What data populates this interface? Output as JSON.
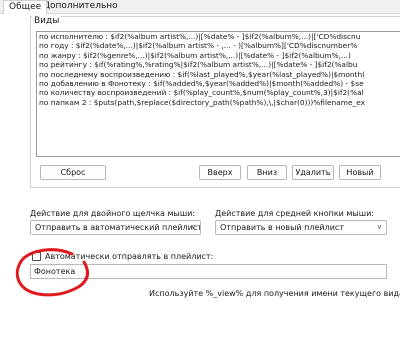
{
  "tabs": [
    {
      "label": "Общее",
      "active": true
    },
    {
      "label": "Дополнительно",
      "active": false
    }
  ],
  "views_group": {
    "label": "Виды",
    "rows": [
      "по исполнителю : $if2(%album artist%,...)|[%date% - ]$if2(%album%,...)|['CD%discnu",
      "по году : $if2(%date%,...)|$if2(%album artist% - ,... - )[%album%]['CD%discnumber%",
      "по жанру : $if2(%genre%,...)|$if2(%album artist%,...)|[%date% - ]$if2(%album%,...)",
      "по рейтингу : $if(%rating%,%rating%|$if2(%album artist%,...)|[%date% - ]$if2(%albu",
      "по последнему воспроизведению : $if(%last_played%,$year(%last_played%)|$month(",
      "по добавлению в Фонотеку : $if(%added%,$year(%added%)|$month(%added%) - $se",
      "по количеству воспроизведений : $if(%play_count%,$num(%play_count%,3)|$if2(%al",
      "по папкам 2 : $puts(path,$replace($directory_path(%path%),\\,|$char(0)))%filename_ex"
    ],
    "reset_label": "Сброс",
    "up_label": "Вверх",
    "down_label": "Вниз",
    "delete_label": "Удалить",
    "new_label": "Новый"
  },
  "double_click": {
    "label": "Действие для двойного щелчка мыши:",
    "value": "Отправить в автоматический плейлист"
  },
  "middle_click": {
    "label": "Действие для средней кнопки мыши:",
    "value": "Отправить в новый плейлист"
  },
  "auto_send": {
    "checkbox_label": "Автоматически отправлять в плейлист:",
    "checked": false,
    "value": "Фонотека",
    "hint": "Используйте %_view% для получения имени текущего вида"
  },
  "colors": {
    "annotation": "#e0191e"
  }
}
